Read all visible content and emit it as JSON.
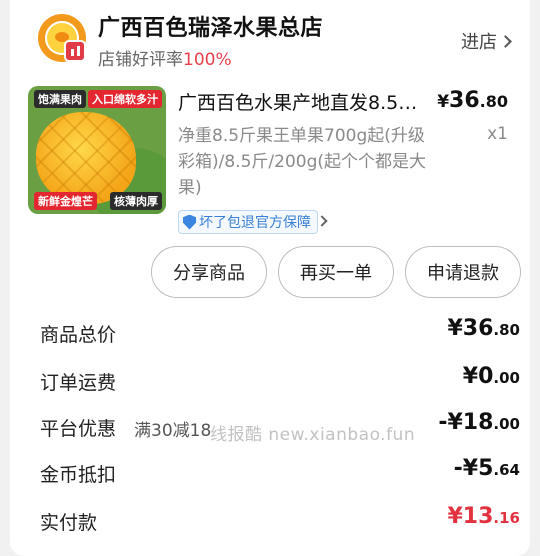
{
  "shop": {
    "name": "广西百色瑞泽水果总店",
    "rating_label": "店铺好评率",
    "rating_value": "100%",
    "enter_label": "进店"
  },
  "product": {
    "image_banner_left": "饱满果肉",
    "image_banner_right": "入口绵软多汁",
    "image_tag_left": "新鲜金煌芒",
    "image_tag_right": "核薄肉厚",
    "title": "广西百色水果产地直发8.5…",
    "price_symbol": "¥",
    "price_int": "36",
    "price_dec": ".80",
    "spec": "净重8.5斤果王单果700g起(升级彩箱)/8.5斤/200g(起个个都是大果)",
    "quantity": "x1",
    "guarantee": "坏了包退官方保障"
  },
  "actions": {
    "share": "分享商品",
    "rebuy": "再买一单",
    "refund": "申请退款"
  },
  "summary": [
    {
      "label": "商品总价",
      "sub": "",
      "int": "¥36",
      "dec": ".80",
      "red": false
    },
    {
      "label": "订单运费",
      "sub": "",
      "int": "¥0",
      "dec": ".00",
      "red": false
    },
    {
      "label": "平台优惠",
      "sub": "满30减18",
      "int": "-¥18",
      "dec": ".00",
      "red": false
    },
    {
      "label": "金币抵扣",
      "sub": "",
      "int": "-¥5",
      "dec": ".64",
      "red": false
    },
    {
      "label": "实付款",
      "sub": "",
      "int": "¥13",
      "dec": ".16",
      "red": true
    }
  ],
  "watermark": "线报酷 new.xianbao.fun",
  "colors": {
    "accent_red": "#e2313f",
    "guarantee_blue": "#3b7fd6"
  }
}
